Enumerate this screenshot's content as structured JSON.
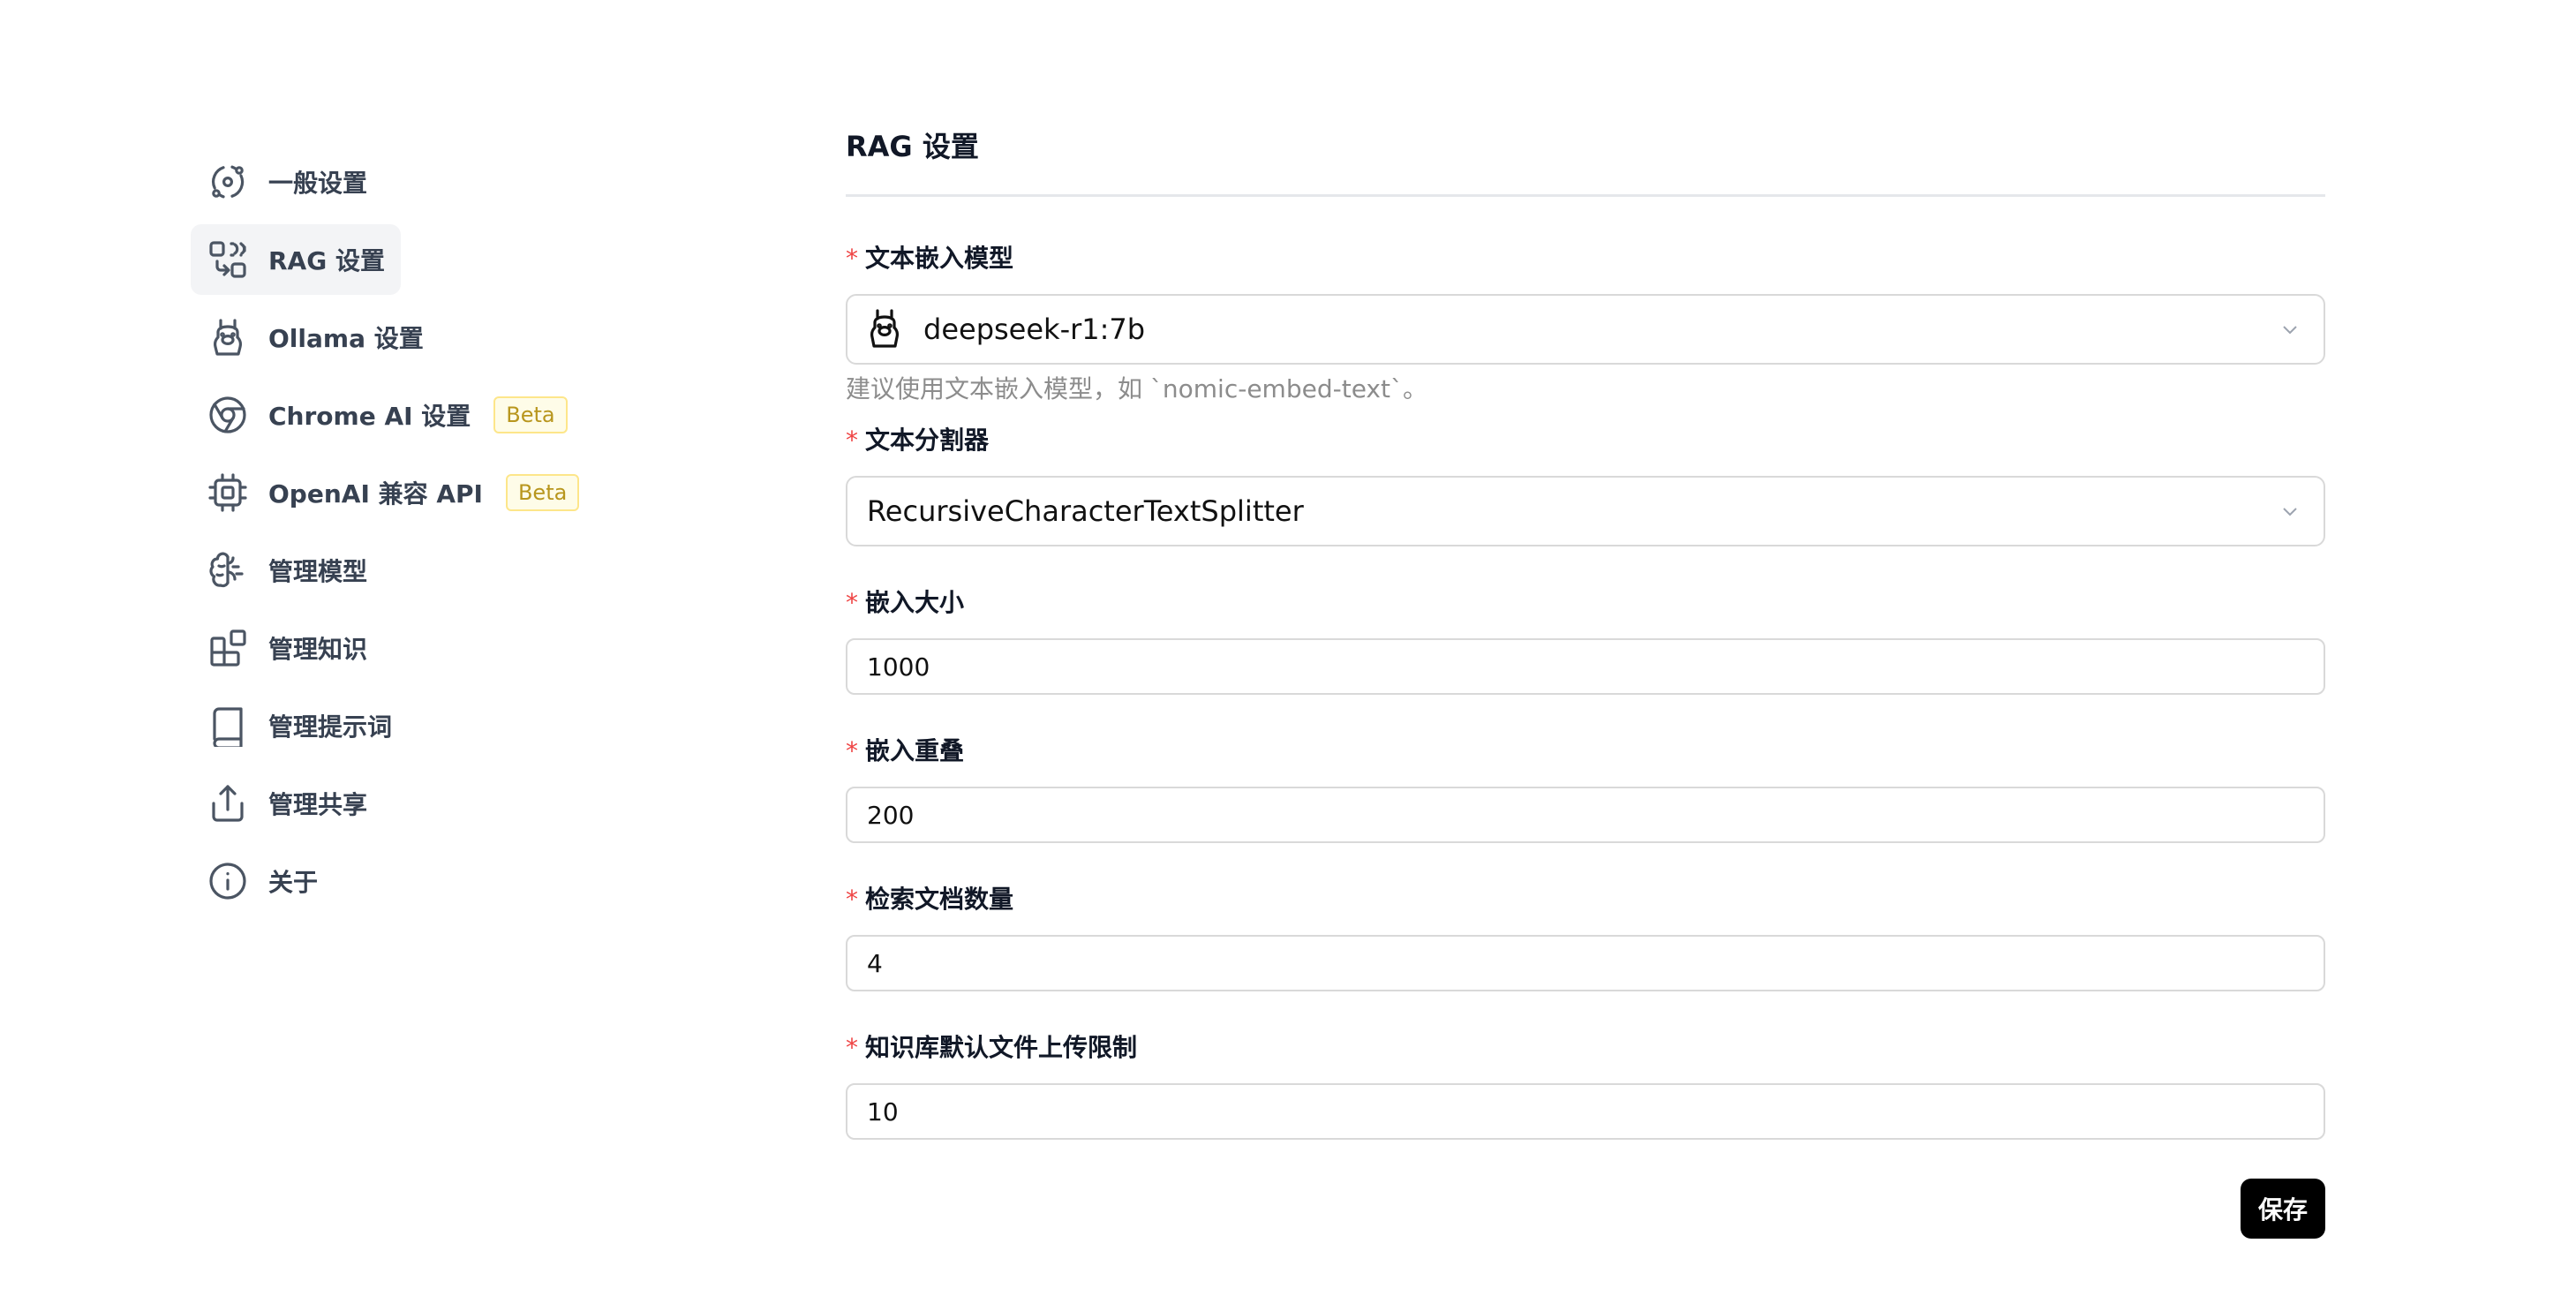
{
  "sidebar": {
    "items": [
      {
        "label": "一般设置",
        "icon": "orbit-icon"
      },
      {
        "label": "RAG 设置",
        "icon": "combine-icon",
        "active": true
      },
      {
        "label": "Ollama 设置",
        "icon": "llama-icon"
      },
      {
        "label": "Chrome AI 设置",
        "icon": "chrome-icon",
        "badge": "Beta"
      },
      {
        "label": "OpenAI 兼容 API",
        "icon": "cpu-icon",
        "badge": "Beta"
      },
      {
        "label": "管理模型",
        "icon": "brain-icon"
      },
      {
        "label": "管理知识",
        "icon": "blocks-icon"
      },
      {
        "label": "管理提示词",
        "icon": "book-icon"
      },
      {
        "label": "管理共享",
        "icon": "share-icon"
      },
      {
        "label": "关于",
        "icon": "info-icon"
      }
    ]
  },
  "main": {
    "title": "RAG 设置",
    "required_mark": "*",
    "embedding_model": {
      "label": "文本嵌入模型",
      "value": "deepseek-r1:7b",
      "help": "建议使用文本嵌入模型，如 `nomic-embed-text`。"
    },
    "splitter": {
      "label": "文本分割器",
      "value": "RecursiveCharacterTextSplitter"
    },
    "chunk_size": {
      "label": "嵌入大小",
      "value": "1000"
    },
    "chunk_overlap": {
      "label": "嵌入重叠",
      "value": "200"
    },
    "doc_count": {
      "label": "检索文档数量",
      "value": "4"
    },
    "upload_limit": {
      "label": "知识库默认文件上传限制",
      "value": "10"
    },
    "save_label": "保存"
  },
  "colors": {
    "required": "#ef4444",
    "active_bg": "#f3f4f6",
    "badge_text": "#b8961d",
    "badge_bg": "#fefce8",
    "save_bg": "#000000"
  }
}
